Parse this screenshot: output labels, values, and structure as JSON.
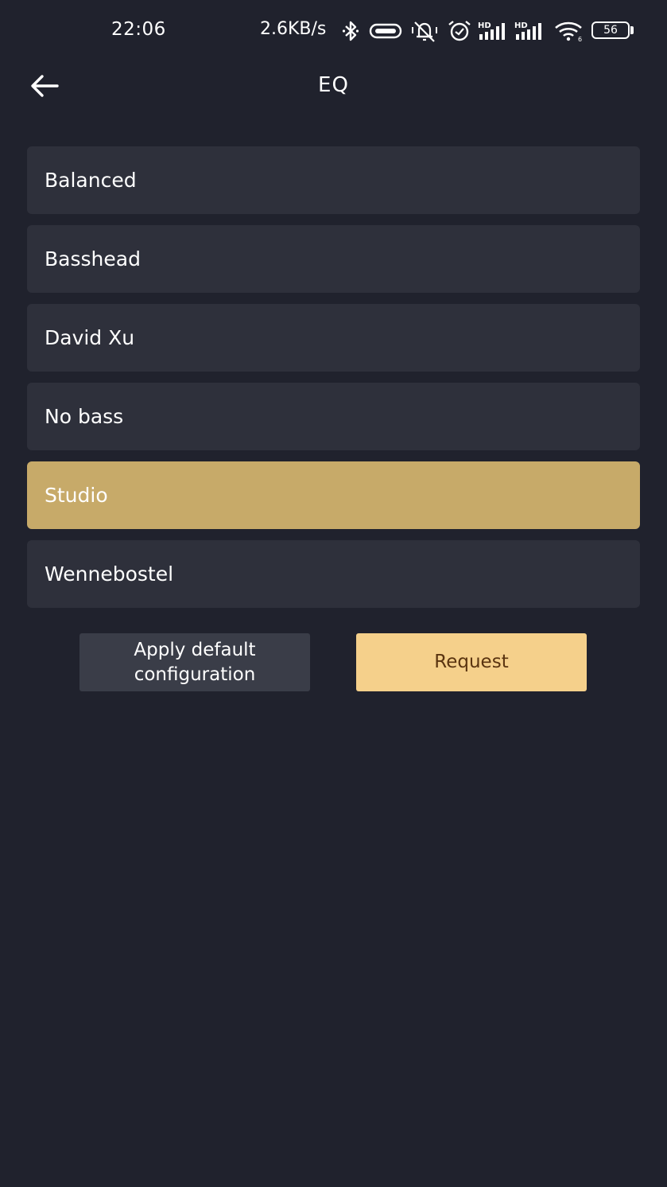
{
  "status_bar": {
    "time": "22:06",
    "network_speed": "2.6KB/s",
    "battery_level": "56",
    "icons": [
      "bluetooth-icon",
      "vibrate-icon",
      "mute-icon",
      "alarm-icon",
      "hd-signal-icon",
      "hd-signal-icon",
      "wifi-icon",
      "battery-icon"
    ]
  },
  "header": {
    "title": "EQ",
    "back_icon": "arrow-left-icon"
  },
  "presets": [
    {
      "label": "Balanced",
      "selected": false
    },
    {
      "label": "Basshead",
      "selected": false
    },
    {
      "label": "David Xu",
      "selected": false
    },
    {
      "label": "No bass",
      "selected": false
    },
    {
      "label": "Studio",
      "selected": true
    },
    {
      "label": "Wennebostel",
      "selected": false
    }
  ],
  "actions": {
    "default_label_line1": "Apply default",
    "default_label_line2": "configuration",
    "request_label": "Request"
  },
  "colors": {
    "background": "#20222d",
    "item_background": "#2e303b",
    "selected_item": "#c7aa69",
    "request_button": "#f5d08b",
    "default_button": "#3a3d48"
  }
}
